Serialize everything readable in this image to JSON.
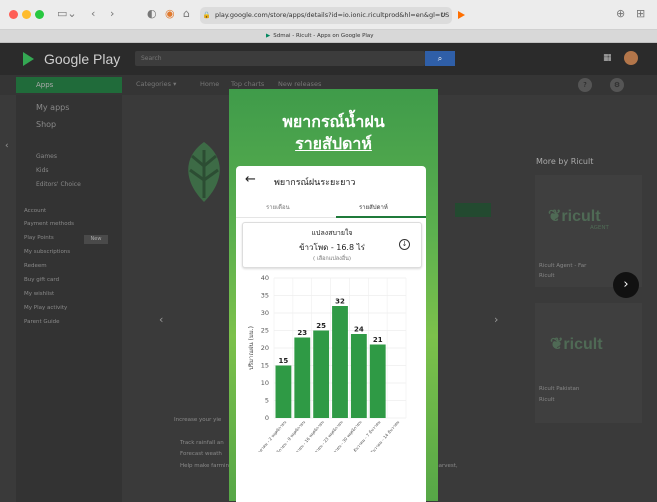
{
  "browser": {
    "url": "play.google.com/store/apps/details?id=io.ionic.ricultprod&hl=en&gl=US",
    "tab_title": "Sdmai - Ricult - Apps on Google Play"
  },
  "play": {
    "logo": "Google Play",
    "search_placeholder": "Search",
    "apps_label": "Apps",
    "subnav": [
      "Categories ▾",
      "Home",
      "Top charts",
      "New releases"
    ],
    "sidebar_main": [
      "My apps",
      "Shop"
    ],
    "sidebar_sub": [
      "Games",
      "Kids",
      "Editors' Choice"
    ],
    "sidebar_account": [
      "Account",
      "Payment methods",
      "Play Points",
      "My subscriptions",
      "Redeem",
      "Buy gift card",
      "My wishlist",
      "My Play activity",
      "Parent Guide"
    ],
    "new_badge": "New",
    "more_by": "More by Ricult",
    "related": [
      {
        "logo": "ricult",
        "logo_sub": "AGENT",
        "name": "Ricult Agent - Far",
        "dev": "Ricult"
      },
      {
        "logo": "ricult",
        "name": "Ricult Pakistan",
        "dev": "Ricult"
      }
    ],
    "description": [
      "Increase your yie",
      "Track rainfall an",
      "Forecast weath",
      "Help make farming decision based on weather forecast such as when to plant, put fertilizer, harvest,"
    ]
  },
  "phone": {
    "heading_line1": "พยากรณ์น้ำฝน",
    "heading_line2": "รายสัปดาห์",
    "card_title": "พยากรณ์ฝนระยะยาว",
    "tab_monthly": "รายเดือน",
    "tab_weekly": "รายสัปดาห์",
    "crop_line1": "แปลงสบายใจ",
    "crop_line2": "ข้าวโพด - 16.8 ไร่",
    "crop_line3": "( เลือกแปลงอื่น)",
    "icons": {
      "back": "arrow-left-icon",
      "dropdown": "chevron-circle-down-icon"
    }
  },
  "chart_data": {
    "type": "bar",
    "ylabel": "ปริมาณฝน (มม.)",
    "ylim": [
      0,
      40
    ],
    "yticks": [
      0,
      5,
      10,
      15,
      20,
      25,
      30,
      35,
      40
    ],
    "categories": [
      "27 ตุลาคม - 2 พฤศจิกายน",
      "3 พฤศจิกายน - 9 พฤศจิกายน",
      "10 พฤศจิกายน - 16 พฤศจิกายน",
      "17 พฤศจิกายน - 23 พฤศจิกายน",
      "24 พฤศจิกายน - 30 พฤศจิกายน",
      "1 ธันวาคม - 7 ธันวาคม",
      "8 ธันวาคม - 14 ธันวาคม"
    ],
    "values": [
      15,
      23,
      25,
      32,
      24,
      21
    ],
    "bar_color": "#2f9a45",
    "grid": true
  },
  "colors": {
    "play_green": "#01875f",
    "bar_green": "#2f9a45",
    "apps_green": "#206b3a"
  }
}
